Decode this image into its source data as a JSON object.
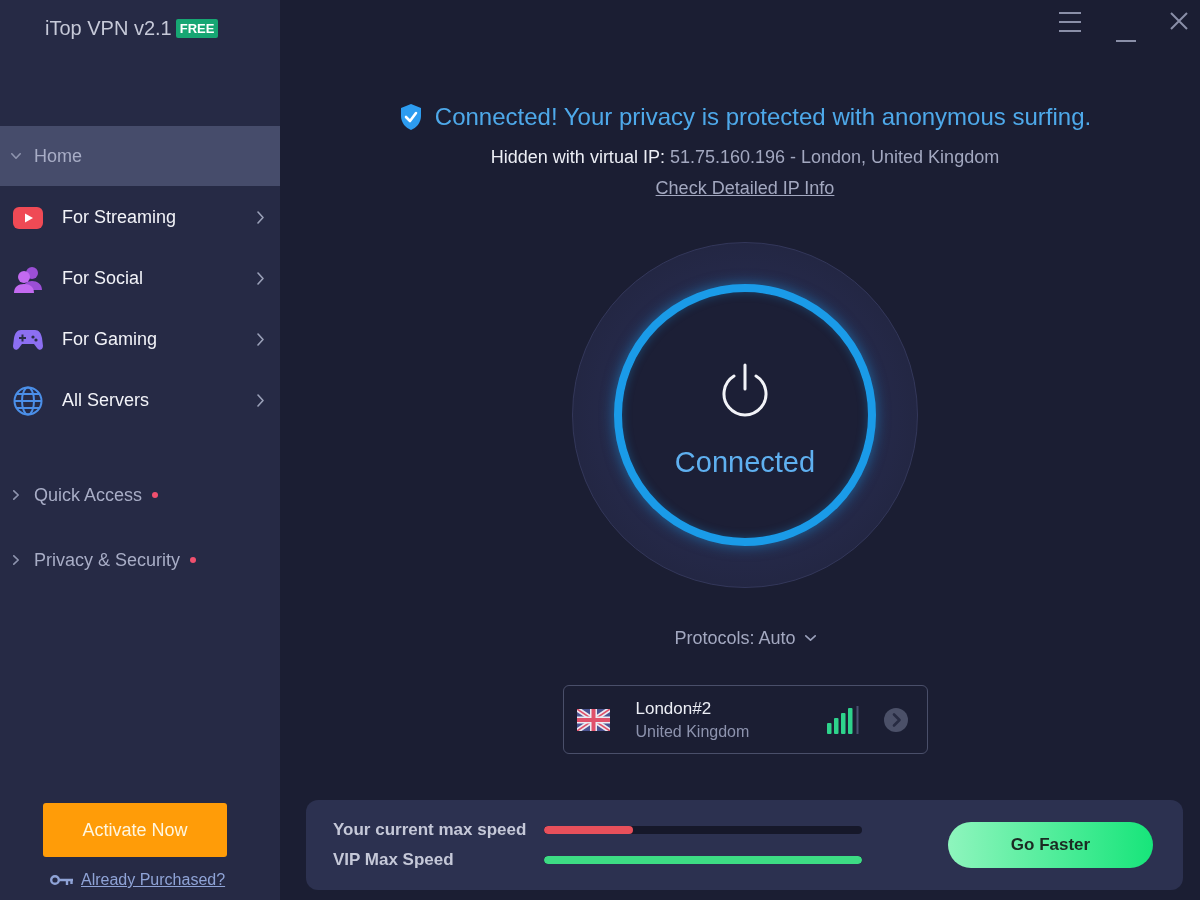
{
  "window": {
    "title": "iTop VPN v2.1",
    "badge": "FREE",
    "controls": [
      {
        "kind": "menu"
      },
      {
        "kind": "minimize"
      },
      {
        "kind": "close"
      }
    ]
  },
  "sidebar": {
    "items": [
      {
        "label": "Home",
        "selected": true,
        "expanded": true,
        "unread": false,
        "children": [
          {
            "label": "For Streaming",
            "selected": false
          },
          {
            "label": "For Social",
            "selected": false
          },
          {
            "label": "For Gaming",
            "selected": false
          },
          {
            "label": "All Servers",
            "selected": false
          }
        ]
      },
      {
        "label": "Quick Access",
        "selected": false,
        "expanded": false,
        "unread": true
      },
      {
        "label": "Privacy & Security",
        "selected": false,
        "expanded": false,
        "unread": true
      }
    ],
    "activate_button": "Activate Now",
    "purchased_link": "Already Purchased?"
  },
  "status": {
    "message": "Connected! Your privacy is protected with anonymous surfing.",
    "ip_label": "Hidden with virtual IP:",
    "ip_value": "51.75.160.196 - London, United Kingdom",
    "link": "Check Detailed IP Info"
  },
  "power": {
    "on": true,
    "label": "Connected"
  },
  "protocol": {
    "label": "Protocols: Auto"
  },
  "server": {
    "name": "London#2",
    "country": "United Kingdom"
  },
  "speed": {
    "rows": [
      {
        "label": "Your current max speed",
        "level": 0.28,
        "color": "#e8505b"
      },
      {
        "label": "VIP Max Speed",
        "level": 1,
        "color": "#3ddc84"
      }
    ],
    "button": "Go Faster"
  }
}
